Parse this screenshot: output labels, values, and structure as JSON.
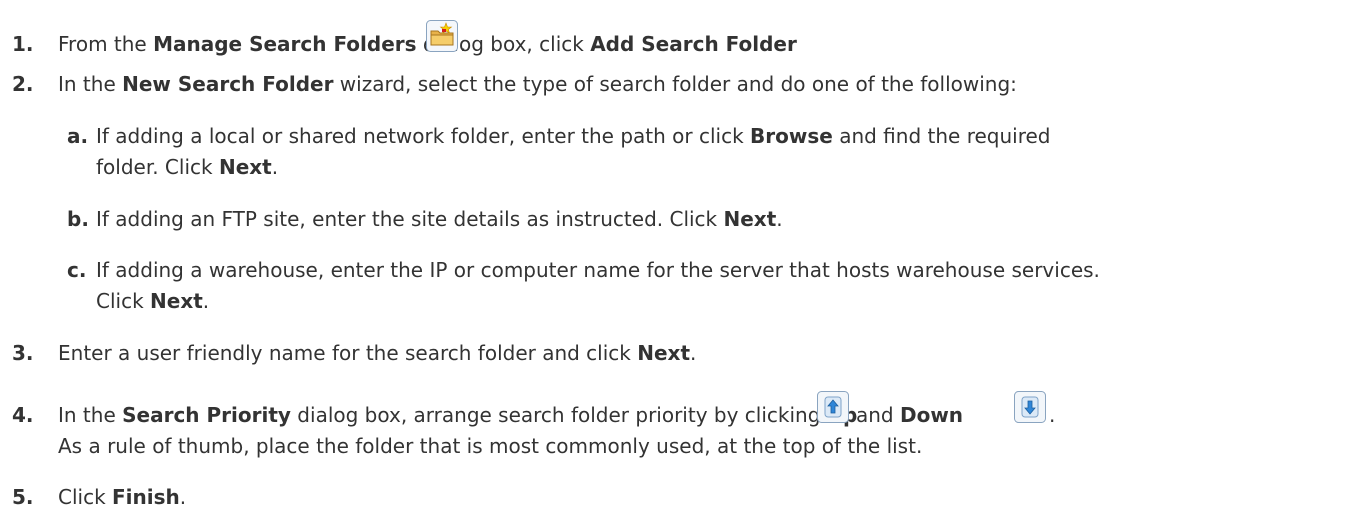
{
  "steps": [
    {
      "num": "1.",
      "pre": "From the ",
      "b1": "Manage Search Folders",
      "mid": " dialog box, click ",
      "b2": "Add Search Folder",
      "post": "."
    },
    {
      "num": "2.",
      "pre": "In the ",
      "b1": "New Search Folder",
      "post": " wizard, select the type of search folder and do one of the following:"
    },
    {
      "num": "3.",
      "pre": "Enter a user friendly name for the search folder and click ",
      "b1": "Next",
      "post": "."
    },
    {
      "num": "4.",
      "pre": "In the ",
      "b1": "Search Priority",
      "mid": " dialog box, arrange search folder priority by clicking ",
      "b2": "Up",
      "mid2": " and ",
      "b3": "Down",
      "post": ".",
      "line2": "As a rule of thumb, place the folder that is most commonly used, at the top of the list."
    },
    {
      "num": "5.",
      "pre": "Click ",
      "b1": "Finish",
      "post": "."
    }
  ],
  "substeps": [
    {
      "letter": "a.",
      "pre": "If adding a local or shared network folder, enter the path or click ",
      "b1": "Browse",
      "post": " and find the required",
      "line2_pre": "folder.  Click ",
      "line2_b": "Next",
      "line2_post": "."
    },
    {
      "letter": "b.",
      "pre": "If adding an FTP site, enter the site details as instructed.  Click ",
      "b1": "Next",
      "post": "."
    },
    {
      "letter": "c.",
      "pre": "If adding a warehouse, enter the IP or computer name for the server that hosts warehouse services.",
      "line2_pre": "Click ",
      "line2_b": "Next",
      "line2_post": "."
    }
  ],
  "icons": {
    "add_folder": "add-search-folder-icon",
    "up": "up-arrow-icon",
    "down": "down-arrow-icon"
  }
}
